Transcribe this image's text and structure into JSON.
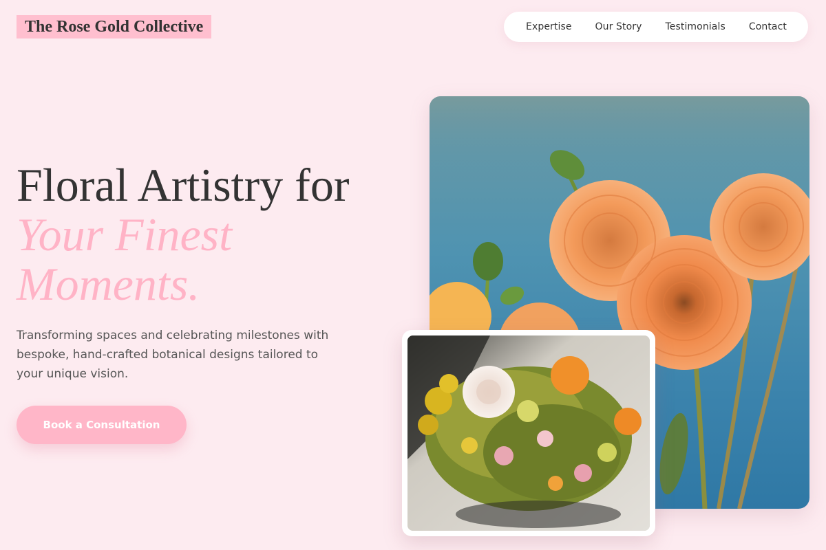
{
  "brand": {
    "name": "The Rose Gold Collective"
  },
  "nav": {
    "items": [
      {
        "label": "Expertise"
      },
      {
        "label": "Our Story"
      },
      {
        "label": "Testimonials"
      },
      {
        "label": "Contact"
      }
    ]
  },
  "hero": {
    "title_line1": "Floral Artistry for",
    "title_accent_line2": "Your Finest",
    "title_accent_line3": "Moments.",
    "subtitle": "Transforming spaces and celebrating milestones with bespoke, hand-crafted botanical designs tailored to your unique vision.",
    "cta_label": "Book a Consultation"
  },
  "images": {
    "main_subject": "orange-dahlias-photo",
    "secondary_subject": "mixed-bouquet-photo"
  },
  "colors": {
    "background": "#fdebf0",
    "accent_pink": "#ffb3c6",
    "brand_highlight": "#ffbfcf",
    "text_dark": "#333333"
  }
}
